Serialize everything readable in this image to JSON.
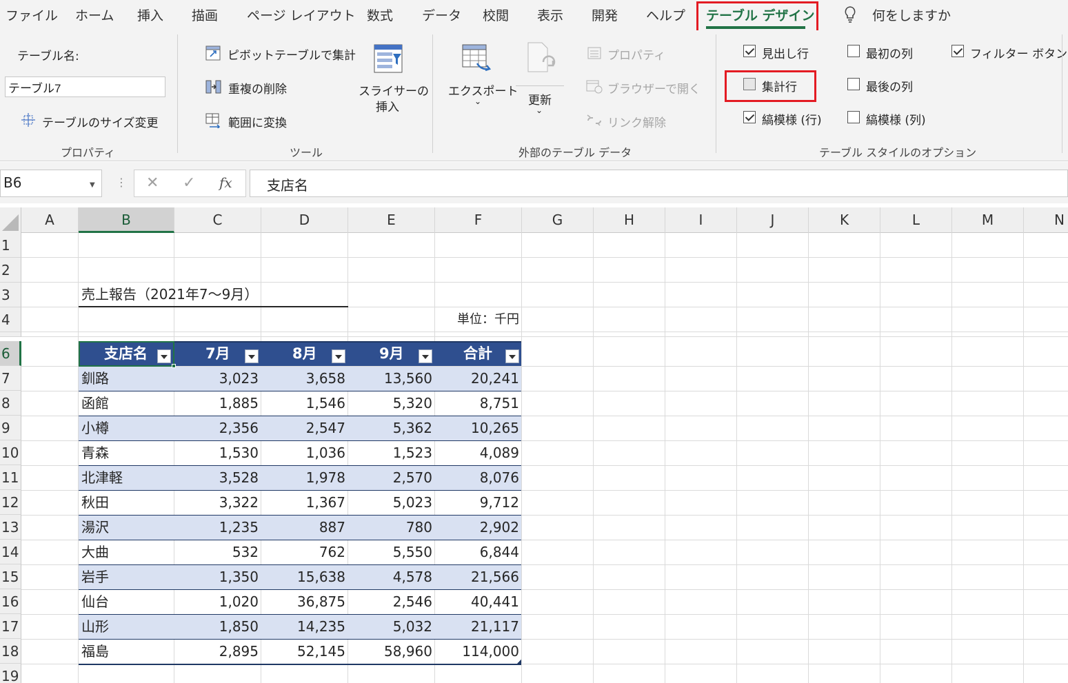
{
  "ribbon_tabs": [
    "ファイル",
    "ホーム",
    "挿入",
    "描画",
    "ページ レイアウト",
    "数式",
    "データ",
    "校閲",
    "表示",
    "開発",
    "ヘルプ",
    "テーブル デザイン"
  ],
  "tell_me": "何をしますか",
  "groups": {
    "properties": {
      "label": "プロパティ",
      "table_name_label": "テーブル名:",
      "table_name_value": "テーブル7",
      "resize_label": "テーブルのサイズ変更"
    },
    "tools": {
      "label": "ツール",
      "pivot": "ピボットテーブルで集計",
      "remove_dup": "重複の削除",
      "convert_range": "範囲に変換",
      "slicer_line1": "スライサーの",
      "slicer_line2": "挿入"
    },
    "external": {
      "label": "外部のテーブル データ",
      "export": "エクスポート",
      "refresh": "更新",
      "properties": "プロパティ",
      "open_browser": "ブラウザーで開く",
      "unlink": "リンク解除"
    },
    "style_options": {
      "label": "テーブル スタイルのオプション",
      "options": [
        {
          "label": "見出し行",
          "checked": true
        },
        {
          "label": "集計行",
          "checked": false
        },
        {
          "label": "縞模様 (行)",
          "checked": true
        },
        {
          "label": "最初の列",
          "checked": false
        },
        {
          "label": "最後の列",
          "checked": false
        },
        {
          "label": "縞模様 (列)",
          "checked": false
        },
        {
          "label": "フィルター ボタン",
          "checked": true
        }
      ]
    }
  },
  "formula_bar": {
    "name_box": "B6",
    "formula": "支店名"
  },
  "columns": [
    "A",
    "B",
    "C",
    "D",
    "E",
    "F",
    "G",
    "H",
    "I",
    "J",
    "K",
    "L",
    "M",
    "N"
  ],
  "rows": [
    "1",
    "2",
    "3",
    "4",
    "6",
    "7",
    "8",
    "9",
    "10",
    "11",
    "12",
    "13",
    "14",
    "15",
    "16",
    "17",
    "18",
    "19"
  ],
  "sheet": {
    "title": "売上報告（2021年7～9月）",
    "unit": "単位：千円",
    "headers": [
      "支店名",
      "7月",
      "8月",
      "9月",
      "合計"
    ],
    "data": [
      [
        "釧路",
        "3,023",
        "3,658",
        "13,560",
        "20,241"
      ],
      [
        "函館",
        "1,885",
        "1,546",
        "5,320",
        "8,751"
      ],
      [
        "小樽",
        "2,356",
        "2,547",
        "5,362",
        "10,265"
      ],
      [
        "青森",
        "1,530",
        "1,036",
        "1,523",
        "4,089"
      ],
      [
        "北津軽",
        "3,528",
        "1,978",
        "2,570",
        "8,076"
      ],
      [
        "秋田",
        "3,322",
        "1,367",
        "5,023",
        "9,712"
      ],
      [
        "湯沢",
        "1,235",
        "887",
        "780",
        "2,902"
      ],
      [
        "大曲",
        "532",
        "762",
        "5,550",
        "6,844"
      ],
      [
        "岩手",
        "1,350",
        "15,638",
        "4,578",
        "21,566"
      ],
      [
        "仙台",
        "1,020",
        "36,875",
        "2,546",
        "40,441"
      ],
      [
        "山形",
        "1,850",
        "14,235",
        "5,032",
        "21,117"
      ],
      [
        "福島",
        "2,895",
        "52,145",
        "58,960",
        "114,000"
      ]
    ]
  },
  "colors": {
    "accent": "#217346",
    "highlight": "#e31b23",
    "table_header": "#2f4f8f",
    "table_band": "#d9e1f2"
  }
}
